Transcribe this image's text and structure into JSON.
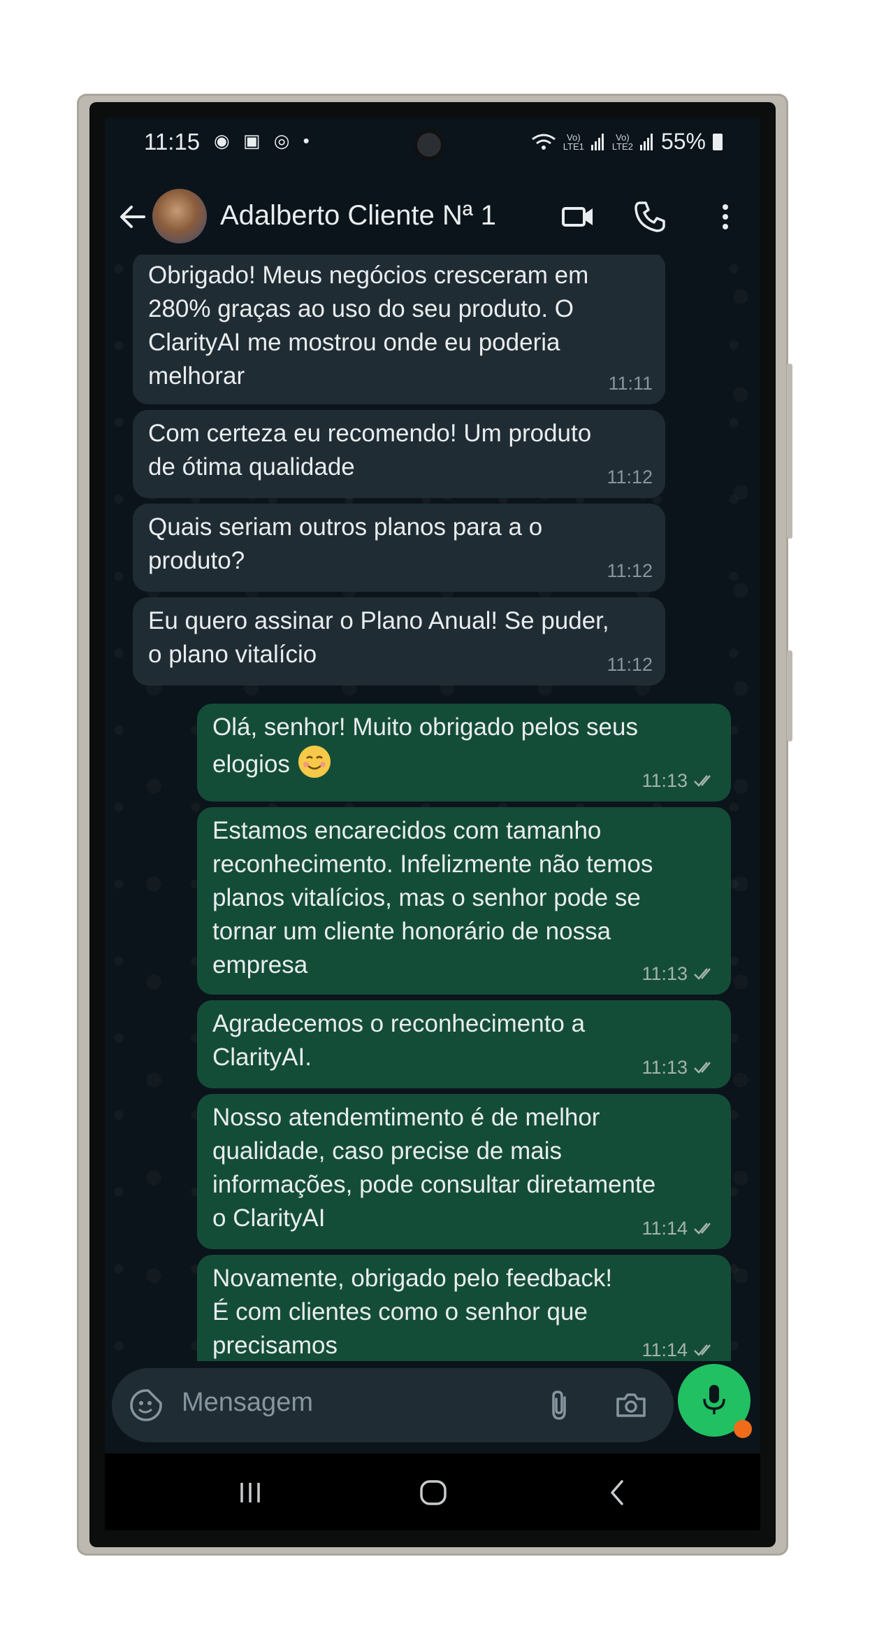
{
  "status_bar": {
    "time": "11:15",
    "left_icons": "◉ ▣ ◎ •",
    "net_top": "Vo)",
    "net_lte1": "LTE1",
    "net_lte2": "LTE2",
    "battery": "55%"
  },
  "header": {
    "contact_name": "Adalberto Cliente Nª 1"
  },
  "messages": [
    {
      "direction": "in",
      "text": "Obrigado! Meus negócios cresceram em\n280% graças ao uso do seu produto. O\nClarityAI me mostrou onde eu poderia\nmelhorar",
      "time": "11:11"
    },
    {
      "direction": "in",
      "text": "Com certeza eu recomendo! Um produto\nde ótima qualidade",
      "time": "11:12"
    },
    {
      "direction": "in",
      "text": "Quais seriam outros planos para a o\nproduto?",
      "time": "11:12"
    },
    {
      "direction": "in",
      "text": "Eu quero assinar o Plano Anual! Se puder,\no plano vitalício",
      "time": "11:12"
    },
    {
      "direction": "out",
      "text": "Olá, senhor! Muito obrigado pelos seus\nelogios",
      "time": "11:13",
      "emoji": "smiling-face"
    },
    {
      "direction": "out",
      "text": "Estamos encarecidos com tamanho\nreconhecimento. Infelizmente não temos\nplanos vitalícios, mas o senhor pode se\ntornar um cliente honorário de nossa\nempresa",
      "time": "11:13"
    },
    {
      "direction": "out",
      "text": "Agradecemos o reconhecimento a\nClarityAI.",
      "time": "11:13"
    },
    {
      "direction": "out",
      "text": "Nosso atendemtimento é de melhor\nqualidade, caso precise de mais\ninformações, pode consultar diretamente\no ClarityAI",
      "time": "11:14"
    },
    {
      "direction": "out",
      "text": "Novamente, obrigado pelo feedback!\nÉ com clientes como o senhor que\nprecisamos",
      "time": "11:14"
    }
  ],
  "input": {
    "placeholder": "Mensagem"
  },
  "icons": {
    "header": [
      "back-arrow-icon",
      "avatar",
      "video-call-icon",
      "phone-icon",
      "more-vert-icon"
    ],
    "input": [
      "emoji-sticker-icon",
      "attach-icon",
      "camera-icon",
      "mic-icon"
    ],
    "nav": [
      "recent-apps-icon",
      "home-icon",
      "back-nav-icon"
    ]
  },
  "colors": {
    "chat_bg": "#0b141a",
    "incoming_bubble": "#202c33",
    "outgoing_bubble": "#144d37",
    "accent_green": "#21c063"
  }
}
